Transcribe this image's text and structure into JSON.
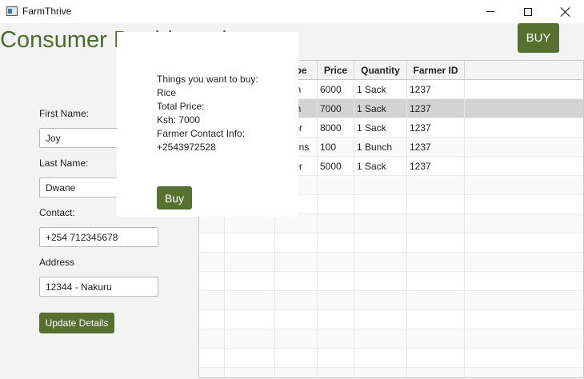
{
  "window": {
    "title": "FarmThrive"
  },
  "header": {
    "title": "Consumer Dashboard",
    "buy_label": "BUY"
  },
  "form": {
    "first_name_label": "First Name:",
    "first_name_value": "Joy",
    "last_name_label": "Last Name:",
    "last_name_value": "Dwane",
    "contact_label": "Contact:",
    "contact_value": "+254 712345678",
    "address_label": "Address",
    "address_value": "12344 - Nakuru",
    "update_label": "Update Details"
  },
  "table": {
    "columns": [
      "",
      "",
      "Type",
      "Price",
      "Quantity",
      "Farmer ID"
    ],
    "rows": [
      [
        "",
        "",
        "Grain",
        "6000",
        "1 Sack",
        "1237"
      ],
      [
        "",
        "",
        "Grain",
        "7000",
        "1 Sack",
        "1237"
      ],
      [
        "",
        "",
        "Tuber",
        "8000",
        "1 Sack",
        "1237"
      ],
      [
        "",
        "",
        "Greens",
        "100",
        "1 Bunch",
        "1237"
      ],
      [
        "",
        "",
        "Tuber",
        "5000",
        "1 Sack",
        "1237"
      ]
    ]
  },
  "popup": {
    "want_label": "Things you want to buy:",
    "item": "Rice",
    "total_label": "Total Price:",
    "total_value": "Ksh: 7000",
    "contact_label": "Farmer Contact Info:",
    "contact_value": "+2543972528",
    "buy_label": "Buy"
  }
}
